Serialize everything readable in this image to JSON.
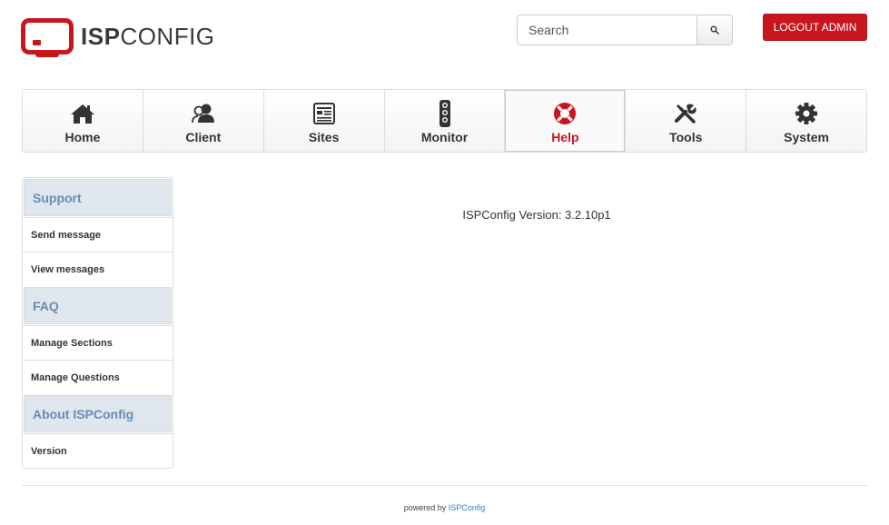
{
  "header": {
    "logo_bold": "ISP",
    "logo_thin": "CONFIG",
    "search": {
      "placeholder": "Search"
    },
    "logout_label": "LOGOUT ADMIN"
  },
  "nav": {
    "items": [
      {
        "label": "Home",
        "icon": "home-icon"
      },
      {
        "label": "Client",
        "icon": "users-icon"
      },
      {
        "label": "Sites",
        "icon": "document-icon"
      },
      {
        "label": "Monitor",
        "icon": "traffic-light-icon"
      },
      {
        "label": "Help",
        "icon": "lifebuoy-icon",
        "active": true
      },
      {
        "label": "Tools",
        "icon": "wrench-icon"
      },
      {
        "label": "System",
        "icon": "gear-icon"
      }
    ]
  },
  "sidebar": {
    "sections": [
      {
        "heading": "Support",
        "links": [
          "Send message",
          "View messages"
        ]
      },
      {
        "heading": "FAQ",
        "links": [
          "Manage Sections",
          "Manage Questions"
        ]
      },
      {
        "heading": "About ISPConfig",
        "links": [
          "Version"
        ]
      }
    ]
  },
  "main": {
    "version_text": "ISPConfig Version: 3.2.10p1"
  },
  "footer": {
    "prefix": "powered by",
    "link": "ISPConfig"
  },
  "colors": {
    "brand_red": "#c8161d",
    "sidebar_heading_bg": "#dfe6ee",
    "sidebar_heading_text": "#6a8cb2",
    "link_blue": "#3a7bc8"
  }
}
